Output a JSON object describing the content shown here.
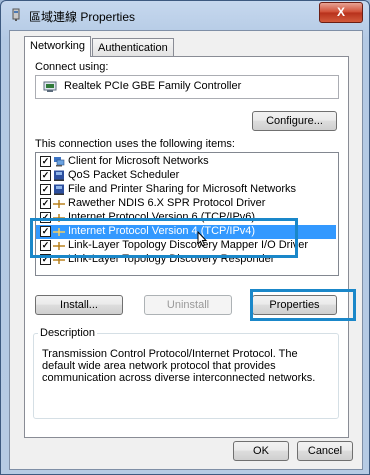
{
  "window": {
    "title": "區域連線 Properties",
    "close_label": "X"
  },
  "tabs": [
    {
      "label": "Networking"
    },
    {
      "label": "Authentication"
    }
  ],
  "networking": {
    "connect_using_label": "Connect using:",
    "adapter_name": "Realtek PCIe GBE Family Controller",
    "configure_label": "Configure...",
    "items_label": "This connection uses the following items:",
    "items": [
      {
        "label": "Client for Microsoft Networks",
        "checked": true,
        "icon": "network-client-icon"
      },
      {
        "label": "QoS Packet Scheduler",
        "checked": true,
        "icon": "network-service-icon"
      },
      {
        "label": "File and Printer Sharing for Microsoft Networks",
        "checked": true,
        "icon": "network-service-icon"
      },
      {
        "label": "Rawether NDIS 6.X SPR Protocol Driver",
        "checked": true,
        "icon": "protocol-icon"
      },
      {
        "label": "Internet Protocol Version 6 (TCP/IPv6)",
        "checked": true,
        "icon": "protocol-icon"
      },
      {
        "label": "Internet Protocol Version 4 (TCP/IPv4)",
        "checked": true,
        "icon": "protocol-icon",
        "selected": true
      },
      {
        "label": "Link-Layer Topology Discovery Mapper I/O Driver",
        "checked": true,
        "icon": "protocol-icon"
      },
      {
        "label": "Link-Layer Topology Discovery Responder",
        "checked": true,
        "icon": "protocol-icon"
      }
    ],
    "install_label": "Install...",
    "uninstall_label": "Uninstall",
    "properties_label": "Properties",
    "description_legend": "Description",
    "description_text": "Transmission Control Protocol/Internet Protocol. The default wide area network protocol that provides communication across diverse interconnected networks."
  },
  "footer": {
    "ok_label": "OK",
    "cancel_label": "Cancel"
  },
  "colors": {
    "selection": "#3399ff",
    "callout": "#1a87c9",
    "close_button": "#c9432c"
  }
}
